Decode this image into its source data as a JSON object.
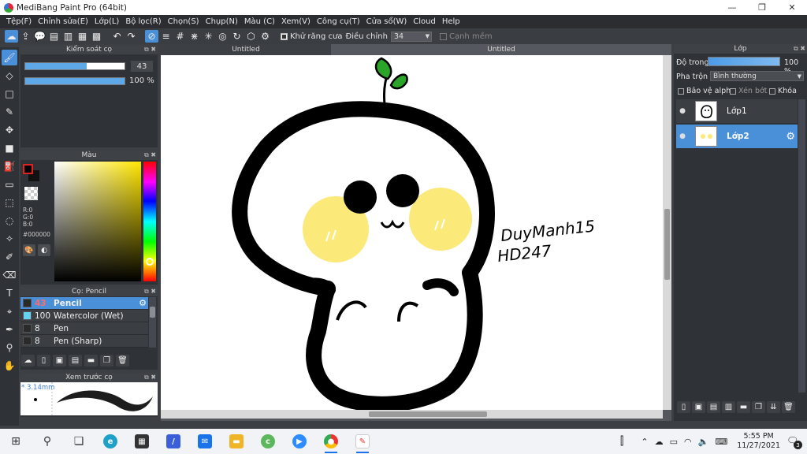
{
  "window": {
    "title": "MediBang Paint Pro (64bit)",
    "minimize": "—",
    "restore": "❐",
    "close": "✕"
  },
  "menu": [
    "Tệp(F)",
    "Chỉnh sửa(E)",
    "Lớp(L)",
    "Bộ lọc(R)",
    "Chọn(S)",
    "Chụp(N)",
    "Màu (C)",
    "Xem(V)",
    "Công cụ(T)",
    "Cửa sổ(W)",
    "Cloud",
    "Help"
  ],
  "toolbar": {
    "antialias_label": "Khử răng cưa",
    "adjust_label": "Điều chỉnh",
    "adjust_value": "34",
    "edge_label": "Cạnh mềm"
  },
  "brush_control": {
    "header": "Kiểm soát cọ",
    "size_value": "43",
    "size_fill": 0.62,
    "opacity_value": "100 %",
    "opacity_fill": 1.0
  },
  "color": {
    "header": "Màu",
    "r": "R:0",
    "g": "G:0",
    "b": "B:0",
    "hex": "#000000"
  },
  "brush_list": {
    "header": "Cọ: Pencil",
    "items": [
      {
        "size": "43",
        "name": "Pencil",
        "color": "#2a2a2a"
      },
      {
        "size": "100",
        "name": "Watercolor (Wet)",
        "color": "#66d4f0"
      },
      {
        "size": "8",
        "name": "Pen",
        "color": "#2a2a2a"
      },
      {
        "size": "8",
        "name": "Pen (Sharp)",
        "color": "#2a2a2a"
      }
    ]
  },
  "preview": {
    "header": "Xem trước cọ",
    "size_label": "* 3.14mm"
  },
  "documents": {
    "tab1": "Untitled",
    "tab2": "Untitled"
  },
  "signature": {
    "line1": "DuyManh15",
    "line2": "HD247"
  },
  "layers": {
    "header": "Lớp",
    "opacity_label": "Độ trong",
    "opacity_value": "100 %",
    "blend_label": "Pha trộn",
    "blend_value": "Bình thường",
    "protect_alpha": "Bảo vệ alpha",
    "clipping": "Xén bớt",
    "lock": "Khóa",
    "items": [
      {
        "name": "Lớp1"
      },
      {
        "name": "Lớp2"
      }
    ]
  },
  "taskbar": {
    "time": "5:55 PM",
    "date": "11/27/2021",
    "notifications": "3"
  }
}
